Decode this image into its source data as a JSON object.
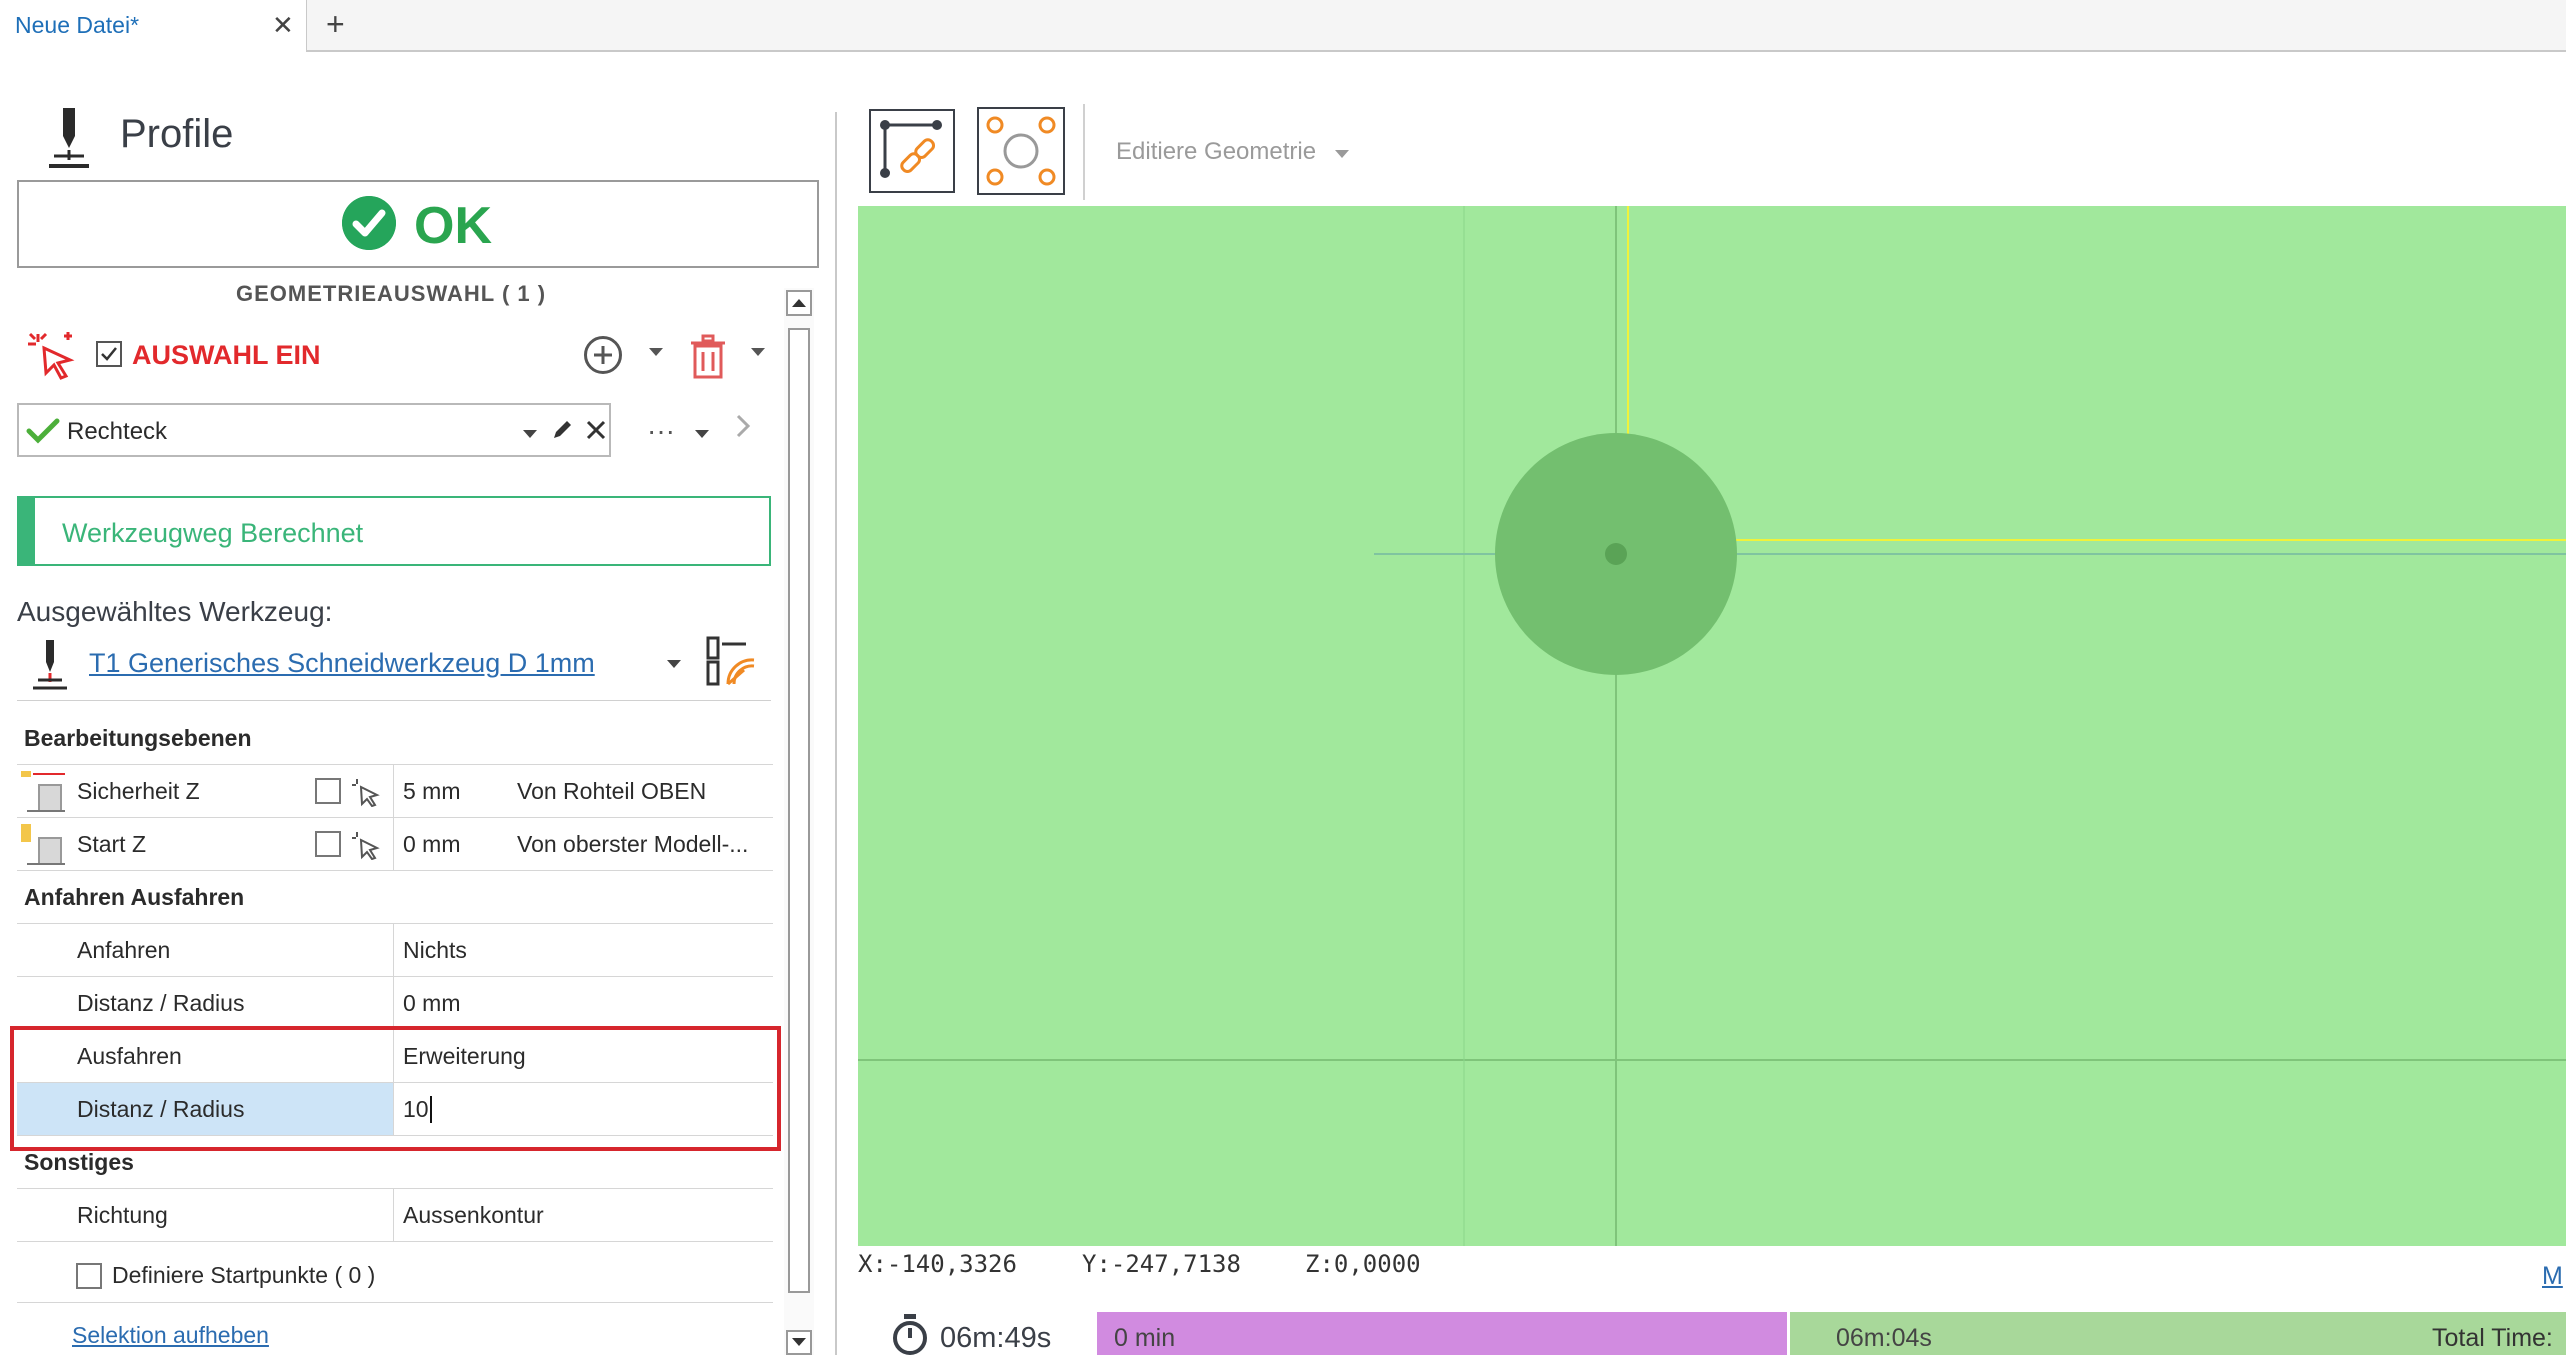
{
  "tabs": {
    "active_title": "Neue Datei*",
    "close_glyph": "✕",
    "add_glyph": "+"
  },
  "panel": {
    "title": "Profile",
    "ok_label": "OK",
    "geometry_heading": "GEOMETRIEAUSWAHL ( 1 )",
    "selection_label": "AUSWAHL EIN",
    "selection_checked": true,
    "geometry_item": "Rechteck",
    "more_glyph": "···",
    "status": "Werkzeugweg Berechnet",
    "tool_heading": "Ausgewähltes Werkzeug",
    "tool_heading_colon": ":",
    "tool_name": "T1 Generisches Schneidwerkzeug D 1mm"
  },
  "grid": {
    "section_planes": "Bearbeitungsebenen",
    "safety_z": {
      "name": "Sicherheit Z",
      "value": "5 mm",
      "reference": "Von Rohteil OBEN"
    },
    "start_z": {
      "name": "Start Z",
      "value": "0 mm",
      "reference": "Von oberster Modell-..."
    },
    "section_approach": "Anfahren Ausfahren",
    "approach": {
      "name": "Anfahren",
      "value": "Nichts"
    },
    "approach_dist": {
      "name": "Distanz / Radius",
      "value": "0 mm"
    },
    "retract": {
      "name": "Ausfahren",
      "value": "Erweiterung"
    },
    "retract_dist": {
      "name": "Distanz / Radius",
      "value": "10"
    },
    "section_misc": "Sonstiges",
    "direction": {
      "name": "Richtung",
      "value": "Aussenkontur"
    },
    "start_points": "Definiere Startpunkte ( 0 )",
    "clear_selection": "Selektion aufheben"
  },
  "toolbar": {
    "edit_geometry": "Editiere Geometrie"
  },
  "viewport": {
    "background": "#a1e89c",
    "coord_x": "X:-140,3326",
    "coord_y": "Y:-247,7138",
    "coord_z": "Z:0,0000",
    "corner_link": "M"
  },
  "timeline": {
    "elapsed": "06m:49s",
    "segment_a": "0 min",
    "segment_b": "06m:04s",
    "total_label": "Total Time:"
  },
  "colors": {
    "accent_blue": "#1e6fb8",
    "ok_green": "#2aa54f",
    "status_green": "#3ab579",
    "alert_red": "#e2292c",
    "highlight_frame": "#d6262d"
  }
}
